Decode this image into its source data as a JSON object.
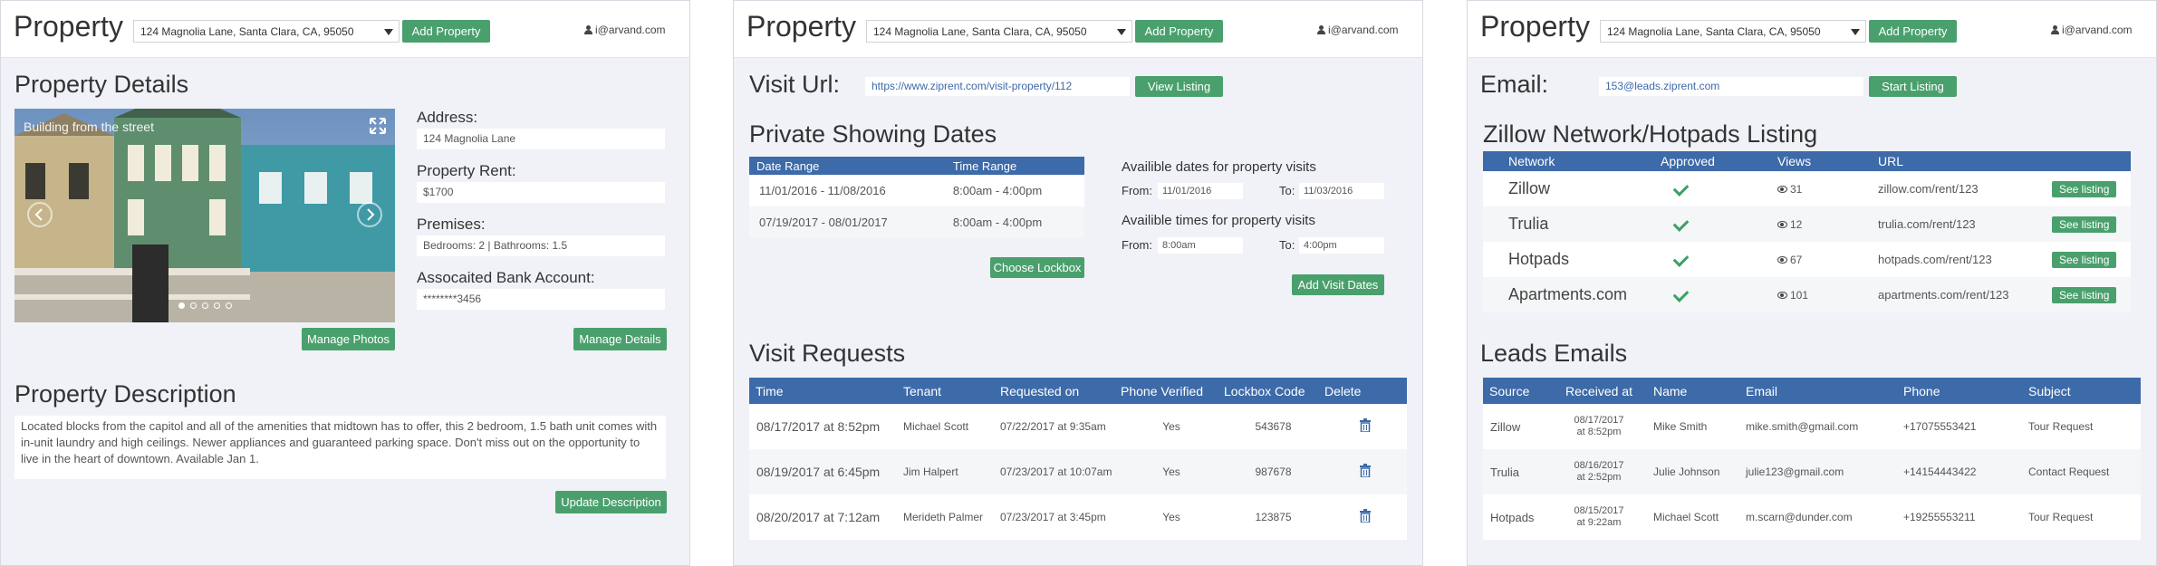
{
  "header": {
    "brand": "Property",
    "address_value": "124 Magnolia Lane, Santa Clara, CA, 95050",
    "add_property_label": "Add Property",
    "user_email": "i@arvand.com"
  },
  "panel1": {
    "details_title": "Property Details",
    "photo_caption": "Building from the street",
    "address_label": "Address:",
    "address_value": "124 Magnolia Lane",
    "rent_label": "Property Rent:",
    "rent_value": "$1700",
    "premises_label": "Premises:",
    "premises_value": "Bedrooms: 2 | Bathrooms: 1.5",
    "bank_label": "Assocaited Bank Account:",
    "bank_value": "********3456",
    "manage_photos_label": "Manage Photos",
    "manage_details_label": "Manage Details",
    "description_title": "Property Description",
    "description_text": "Located blocks from the capitol and all of the amenities that midtown has to offer, this 2 bedroom, 1.5 bath unit comes with in-unit laundry and high ceilings. Newer appliances and guaranteed parking space. Don't miss out on the opportunity to live in the heart of downtown. Available Jan 1.",
    "update_description_label": "Update Description"
  },
  "panel2": {
    "visit_url_label": "Visit Url:",
    "visit_url_value": "https://www.ziprent.com/visit-property/112",
    "view_listing_label": "View Listing",
    "showing_title": "Private Showing Dates",
    "showing_headers": [
      "Date Range",
      "Time Range"
    ],
    "showing_rows": [
      [
        "11/01/2016 - 11/08/2016",
        "8:00am - 4:00pm"
      ],
      [
        "07/19/2017 - 08/01/2017",
        "8:00am - 4:00pm"
      ]
    ],
    "choose_lockbox_label": "Choose Lockbox",
    "avail_dates_title": "Availible dates for property visits",
    "from_label": "From:",
    "to_label": "To:",
    "date_from": "11/01/2016",
    "date_to": "11/03/2016",
    "avail_times_title": "Availible times for property visits",
    "time_from": "8:00am",
    "time_to": "4:00pm",
    "add_visit_dates_label": "Add Visit Dates",
    "requests_title": "Visit Requests",
    "requests_headers": [
      "Time",
      "Tenant",
      "Requested on",
      "Phone Verified",
      "Lockbox Code",
      "Delete"
    ],
    "requests_rows": [
      [
        "08/17/2017 at 8:52pm",
        "Michael Scott",
        "07/22/2017 at 9:35am",
        "Yes",
        "543678"
      ],
      [
        "08/19/2017 at 6:45pm",
        "Jim Halpert",
        "07/23/2017 at 10:07am",
        "Yes",
        "987678"
      ],
      [
        "08/20/2017 at 7:12am",
        "Merideth Palmer",
        "07/23/2017 at 3:45pm",
        "Yes",
        "123875"
      ]
    ]
  },
  "panel3": {
    "email_label": "Email:",
    "email_value": "153@leads.ziprent.com",
    "start_listing_label": "Start Listing",
    "network_title": "Zillow Network/Hotpads Listing",
    "network_headers": [
      "Network",
      "Approved",
      "Views",
      "URL"
    ],
    "network_rows": [
      {
        "network": "Zillow",
        "views": "31",
        "url": "zillow.com/rent/123"
      },
      {
        "network": "Trulia",
        "views": "12",
        "url": "trulia.com/rent/123"
      },
      {
        "network": "Hotpads",
        "views": "67",
        "url": "hotpads.com/rent/123"
      },
      {
        "network": "Apartments.com",
        "views": "101",
        "url": "apartments.com/rent/123"
      }
    ],
    "see_listing_label": "See listing",
    "leads_title": "Leads Emails",
    "leads_headers": [
      "Source",
      "Received at",
      "Name",
      "Email",
      "Phone",
      "Subject"
    ],
    "leads_rows": [
      {
        "source": "Zillow",
        "received_date": "08/17/2017",
        "received_time": "at 8:52pm",
        "name": "Mike Smith",
        "email": "mike.smith@gmail.com",
        "phone": "+17075553421",
        "subject": "Tour Request"
      },
      {
        "source": "Trulia",
        "received_date": "08/16/2017",
        "received_time": "at 2:52pm",
        "name": "Julie Johnson",
        "email": "julie123@gmail.com",
        "phone": "+14154443422",
        "subject": "Contact Request"
      },
      {
        "source": "Hotpads",
        "received_date": "08/15/2017",
        "received_time": "at 9:22am",
        "name": "Michael Scott",
        "email": "m.scarn@dunder.com",
        "phone": "+19255553211",
        "subject": "Tour Request"
      }
    ]
  },
  "colors": {
    "accent_green": "#4aa06d",
    "table_header_blue": "#3d6aa8",
    "panel_bg": "#f0f2f7"
  }
}
